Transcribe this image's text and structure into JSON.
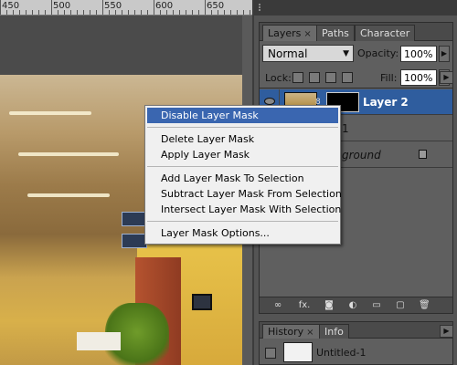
{
  "ruler": {
    "labels": [
      "450",
      "500",
      "550",
      "600",
      "650"
    ]
  },
  "layers_panel": {
    "tabs": [
      {
        "label": "Layers",
        "close": "×"
      },
      {
        "label": "Paths"
      },
      {
        "label": "Character"
      }
    ],
    "blend_mode": "Normal",
    "opacity_label": "Opacity:",
    "opacity_value": "100%",
    "lock_label": "Lock:",
    "fill_label": "Fill:",
    "fill_value": "100%",
    "layers": [
      {
        "name": "Layer 2",
        "selected": true
      },
      {
        "name": "1",
        "selected": false
      },
      {
        "name": "ground",
        "selected": false
      }
    ],
    "footer_icons": [
      "link-icon",
      "fx-icon",
      "mask-icon",
      "adjustment-icon",
      "folder-icon",
      "new-layer-icon",
      "trash-icon"
    ],
    "footer_glyphs": [
      "∞",
      "fx.",
      "◙",
      "◐",
      "▭",
      "▢",
      "🗑"
    ]
  },
  "history_panel": {
    "tabs": [
      {
        "label": "History",
        "close": "×"
      },
      {
        "label": "Info"
      }
    ],
    "item": "Untitled-1"
  },
  "context_menu": {
    "groups": [
      [
        "Disable Layer Mask"
      ],
      [
        "Delete Layer Mask",
        "Apply Layer Mask"
      ],
      [
        "Add Layer Mask To Selection",
        "Subtract Layer Mask From Selection",
        "Intersect Layer Mask With Selection"
      ],
      [
        "Layer Mask Options..."
      ]
    ],
    "highlighted": "Disable Layer Mask"
  },
  "colors": {
    "selection": "#2f5d9e",
    "menu_highlight": "#3a66b0",
    "panel_bg": "#5f5f5f"
  }
}
